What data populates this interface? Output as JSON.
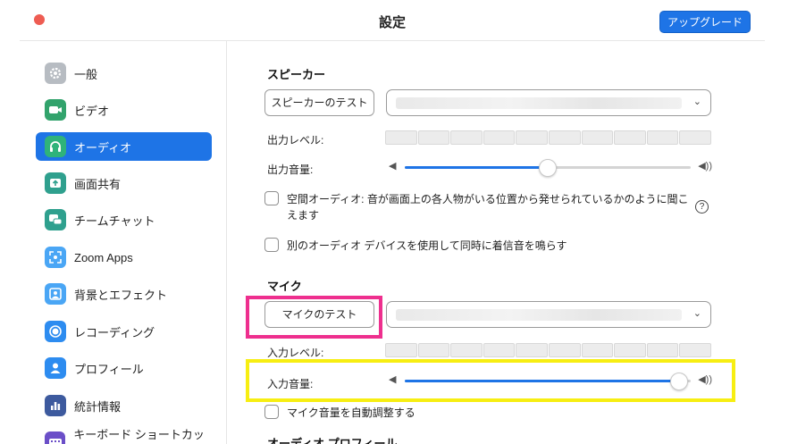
{
  "window": {
    "title": "設定",
    "upgrade_label": "アップグレード"
  },
  "sidebar": {
    "items": [
      {
        "label": "一般",
        "icon": "gear-icon"
      },
      {
        "label": "ビデオ",
        "icon": "video-camera-icon"
      },
      {
        "label": "オーディオ",
        "icon": "headphones-icon",
        "active": true
      },
      {
        "label": "画面共有",
        "icon": "share-screen-icon"
      },
      {
        "label": "チームチャット",
        "icon": "chat-bubbles-icon"
      },
      {
        "label": "Zoom Apps",
        "icon": "apps-icon"
      },
      {
        "label": "背景とエフェクト",
        "icon": "background-icon"
      },
      {
        "label": "レコーディング",
        "icon": "record-icon"
      },
      {
        "label": "プロフィール",
        "icon": "person-icon"
      },
      {
        "label": "統計情報",
        "icon": "bar-chart-icon"
      },
      {
        "label": "キーボード ショートカット",
        "icon": "keyboard-icon"
      }
    ]
  },
  "speaker": {
    "section_title": "スピーカー",
    "test_label": "スピーカーのテスト",
    "output_level_label": "出力レベル:",
    "output_volume_label": "出力音量:",
    "output_volume": 0.5,
    "spatial_audio_label": "空間オーディオ: 音が画面上の各人物がいる位置から発せられているかのように聞こえます",
    "separate_device_label": "別のオーディオ デバイスを使用して同時に着信音を鳴らす"
  },
  "mic": {
    "section_title": "マイク",
    "test_label": "マイクのテスト",
    "input_level_label": "入力レベル:",
    "input_volume_label": "入力音量:",
    "input_volume": 0.96,
    "auto_adjust_label": "マイク音量を自動調整する"
  },
  "audio_profile": {
    "section_title": "オーディオ プロフィール"
  },
  "colors": {
    "accent": "#1e74e6",
    "highlight_magenta": "#ee2f8e",
    "highlight_yellow": "#f7ee12",
    "close_red": "#ee5c52"
  }
}
